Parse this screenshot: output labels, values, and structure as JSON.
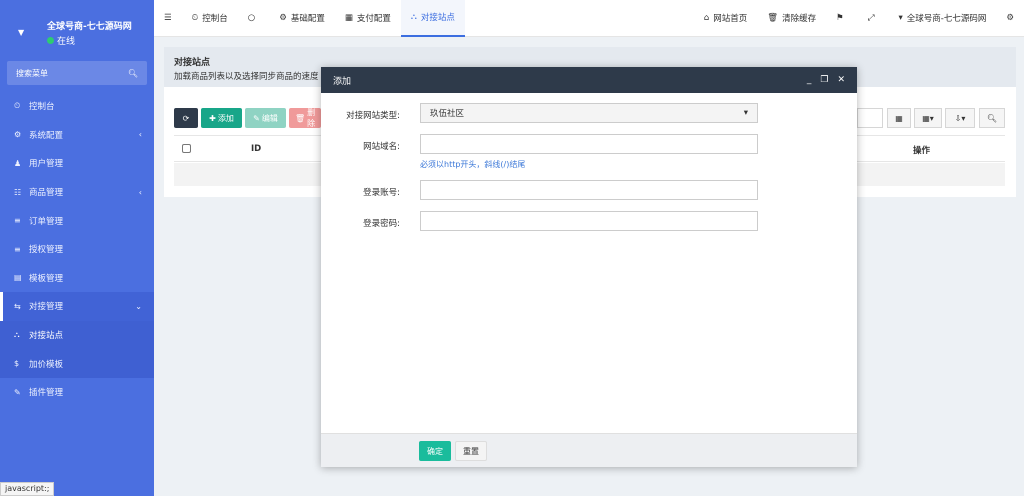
{
  "sidebar": {
    "site_name": "全球号商-七七源码网",
    "status": "在线",
    "search_placeholder": "搜索菜单",
    "items": [
      {
        "label": "控制台",
        "icon": "⏲"
      },
      {
        "label": "系统配置",
        "icon": "⚙"
      },
      {
        "label": "用户管理",
        "icon": "👤"
      },
      {
        "label": "商品管理",
        "icon": "🛒"
      },
      {
        "label": "订单管理",
        "icon": "≡"
      },
      {
        "label": "授权管理",
        "icon": "≡"
      },
      {
        "label": "模板管理",
        "icon": "▤"
      },
      {
        "label": "对接管理",
        "icon": "⇆"
      },
      {
        "label": "对接站点",
        "icon": "⛬"
      },
      {
        "label": "加价模板",
        "icon": "$"
      },
      {
        "label": "插件管理",
        "icon": "✎"
      }
    ]
  },
  "topbar": {
    "tabs": [
      {
        "label": "控制台"
      },
      {
        "label": ""
      },
      {
        "label": "基础配置"
      },
      {
        "label": "支付配置"
      },
      {
        "label": "对接站点"
      }
    ],
    "right": [
      {
        "label": "网站首页"
      },
      {
        "label": "清除缓存"
      },
      {
        "label": ""
      },
      {
        "label": ""
      },
      {
        "label": "全球号商-七七源码网"
      }
    ]
  },
  "panel": {
    "title": "对接站点",
    "subtitle": "加载商品列表以及选择同步商品的速度"
  },
  "toolbar": {
    "add_label": "添加",
    "edit_label": "编辑",
    "delete_label": "删除"
  },
  "table": {
    "col_id": "ID",
    "col_action": "操作"
  },
  "modal": {
    "title": "添加",
    "fields": {
      "type_label": "对接网站类型:",
      "type_value": "玖伍社区",
      "domain_label": "网站域名:",
      "domain_value": "",
      "domain_hint": "必须以http开头，斜线(/)结尾",
      "account_label": "登录账号:",
      "account_value": "",
      "password_label": "登录密码:",
      "password_value": ""
    },
    "confirm_label": "确定",
    "reset_label": "重置"
  },
  "statusbar": {
    "text": "javascript:;"
  },
  "colors": {
    "sidebar": "#4b6fe0",
    "modal_header": "#2e3a4a",
    "confirm": "#1abc9c",
    "add": "#18a689"
  }
}
